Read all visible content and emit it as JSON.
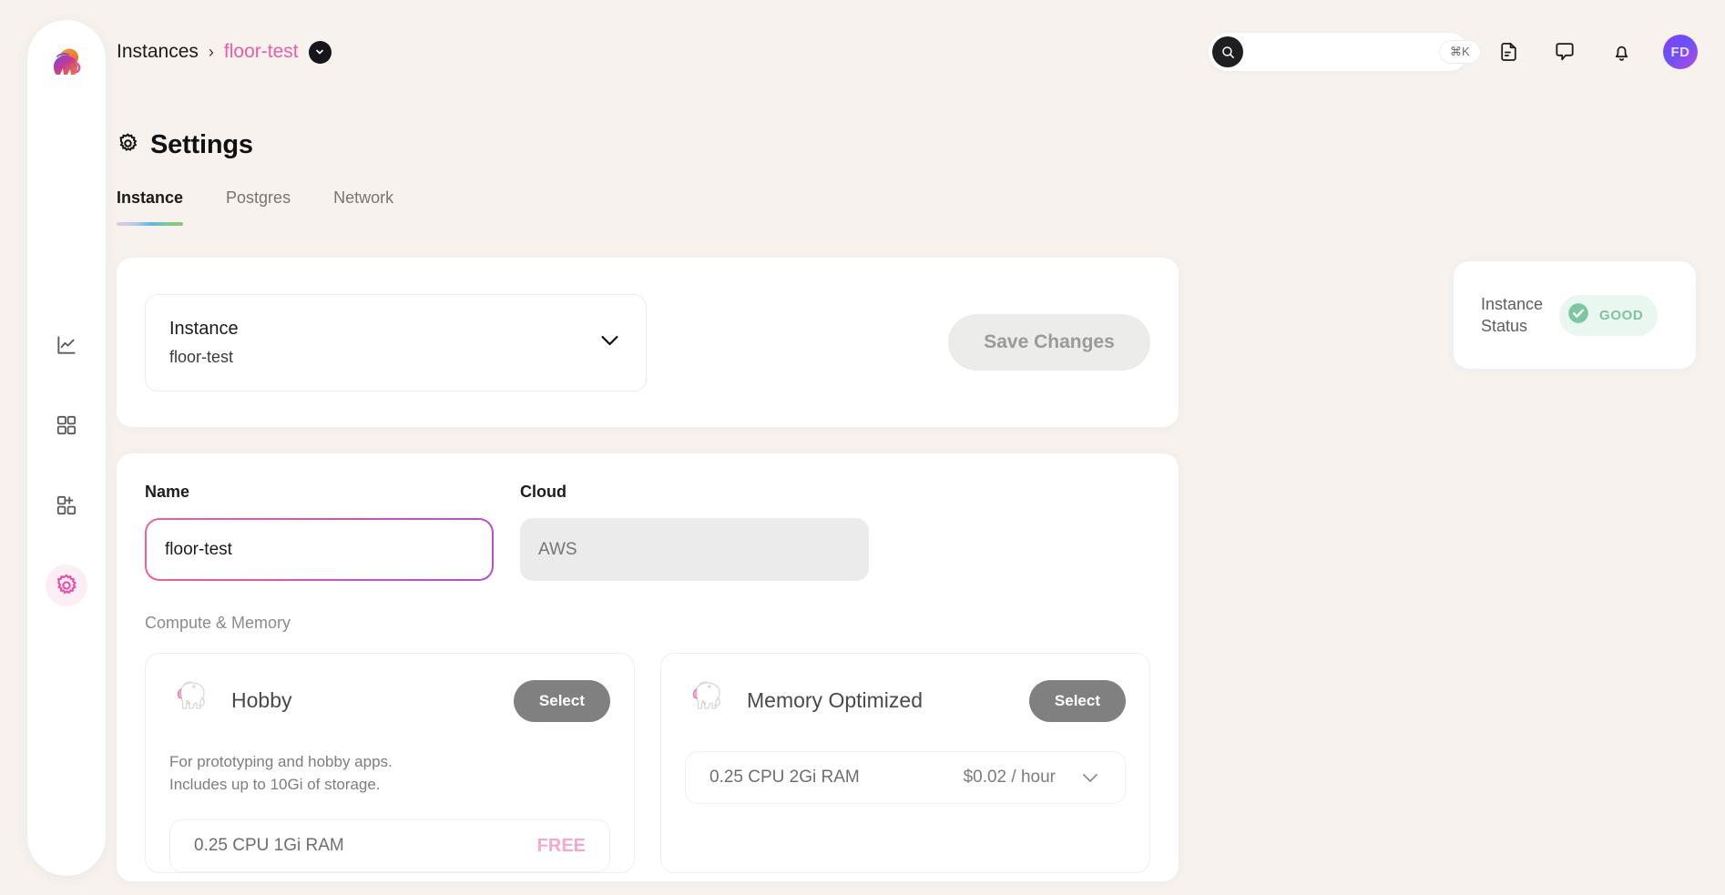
{
  "sidebar": {
    "logo_icon": "elephant-logo",
    "items": [
      {
        "icon": "line-chart-icon",
        "name": "analytics",
        "active": false
      },
      {
        "icon": "grid-icon",
        "name": "instances",
        "active": false
      },
      {
        "icon": "grid-plus-icon",
        "name": "new-instance",
        "active": false
      },
      {
        "icon": "gear-icon",
        "name": "settings",
        "active": true
      }
    ]
  },
  "header": {
    "breadcrumb": {
      "root": "Instances",
      "separator": "›",
      "current": "floor-test"
    },
    "search": {
      "value": "",
      "placeholder": "",
      "shortcut": "⌘K",
      "icon": "search-icon"
    },
    "icons": [
      {
        "name": "document-icon"
      },
      {
        "name": "chat-bubble-icon"
      },
      {
        "name": "bell-icon"
      }
    ],
    "avatar": {
      "initials": "FD"
    }
  },
  "page": {
    "title": "Settings",
    "title_icon": "gear-icon",
    "tabs": [
      {
        "label": "Instance",
        "active": true
      },
      {
        "label": "Postgres",
        "active": false
      },
      {
        "label": "Network",
        "active": false
      }
    ]
  },
  "instance_selector": {
    "label": "Instance",
    "value": "floor-test",
    "chevron_icon": "chevron-down-icon"
  },
  "save_button": {
    "label": "Save Changes",
    "enabled": false
  },
  "status": {
    "label_line1": "Instance",
    "label_line2": "Status",
    "badge_text": "GOOD",
    "badge_icon": "check-circle-icon",
    "badge_color": "#7cc3a0",
    "badge_bg": "#eaf7f0"
  },
  "form": {
    "name": {
      "label": "Name",
      "value": "floor-test",
      "placeholder": ""
    },
    "cloud": {
      "label": "Cloud",
      "value": "AWS",
      "placeholder": "AWS",
      "disabled": true
    },
    "section_label": "Compute & Memory"
  },
  "plans": [
    {
      "name": "Hobby",
      "icon": "elephant-icon",
      "select_label": "Select",
      "description_line1": "For prototyping and hobby apps.",
      "description_line2": "Includes up to 10Gi of storage.",
      "spec": "0.25 CPU 1Gi RAM",
      "price": "FREE",
      "price_is_free": true,
      "has_chevron": false
    },
    {
      "name": "Memory Optimized",
      "icon": "elephant-icon",
      "select_label": "Select",
      "description_line1": "",
      "description_line2": "",
      "spec": "0.25 CPU 2Gi RAM",
      "price": "$0.02 / hour",
      "price_is_free": false,
      "has_chevron": true
    }
  ],
  "colors": {
    "page_bg": "#f7f2ee",
    "accent_pink": "#e95fa5",
    "card_white": "#ffffff",
    "free_pink": "#f7a8cf"
  }
}
